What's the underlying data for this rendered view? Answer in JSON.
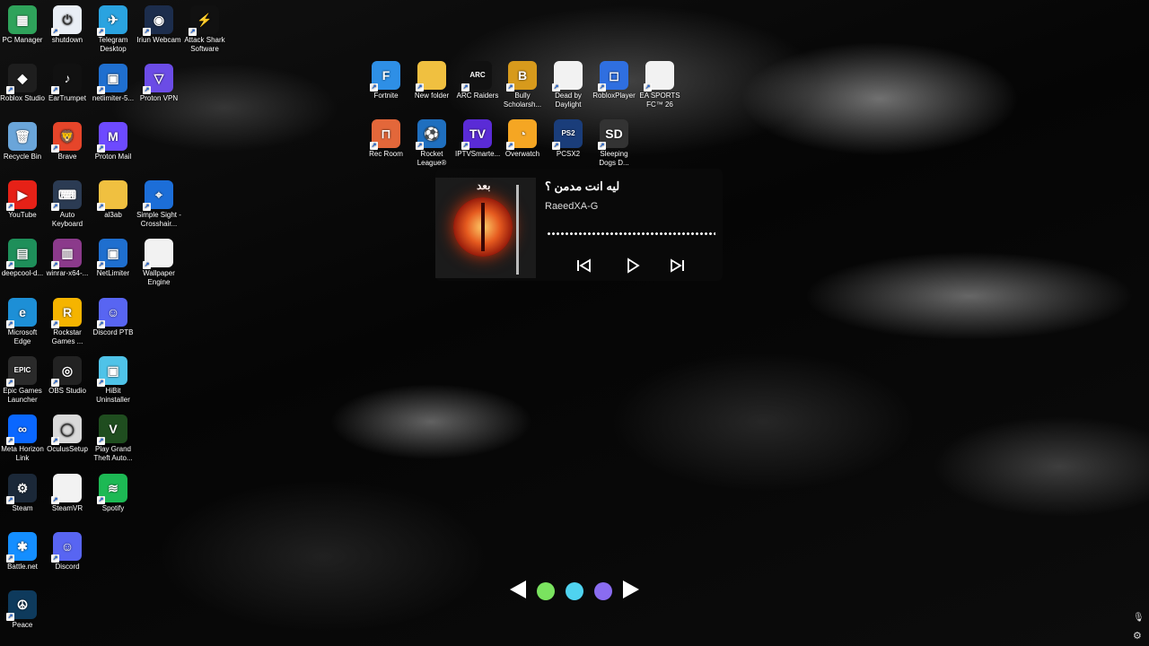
{
  "desktop_icons": [
    {
      "label": "PC Manager",
      "icon": "pc-manager-icon",
      "color": "#2fa35b",
      "glyph": "▦"
    },
    {
      "label": "shutdown",
      "icon": "shutdown-icon",
      "color": "#e9eef5",
      "glyph": "⏻"
    },
    {
      "label": "Telegram Desktop",
      "icon": "telegram-icon",
      "color": "#2aa3e0",
      "glyph": "✈"
    },
    {
      "label": "Iriun Webcam",
      "icon": "webcam-icon",
      "color": "#1c2d4c",
      "glyph": "◉"
    },
    {
      "label": "Attack Shark Software",
      "icon": "attack-shark-icon",
      "color": "#111111",
      "glyph": "⚡"
    },
    {
      "label": "Roblox Studio",
      "icon": "roblox-studio-icon",
      "color": "#1e1e1e",
      "glyph": "◆"
    },
    {
      "label": "EarTrumpet",
      "icon": "eartrumpet-icon",
      "color": "#111111",
      "glyph": "♪"
    },
    {
      "label": "netlimiter-5...",
      "icon": "netlimiter-icon",
      "color": "#1f6fcf",
      "glyph": "▣"
    },
    {
      "label": "Proton VPN",
      "icon": "proton-vpn-icon",
      "color": "#6b4ce6",
      "glyph": "▽"
    },
    {
      "label": "Recycle Bin",
      "icon": "recycle-bin-icon",
      "color": "#6aa5d9",
      "glyph": "🗑"
    },
    {
      "label": "Brave",
      "icon": "brave-icon",
      "color": "#e6452a",
      "glyph": "🦁"
    },
    {
      "label": "Proton Mail",
      "icon": "proton-mail-icon",
      "color": "#6d4aff",
      "glyph": "M"
    },
    {
      "label": "YouTube",
      "icon": "youtube-icon",
      "color": "#e62117",
      "glyph": "▶"
    },
    {
      "label": "Auto Keyboard",
      "icon": "auto-keyboard-icon",
      "color": "#2b3b53",
      "glyph": "⌨"
    },
    {
      "label": "al3ab",
      "icon": "folder-icon",
      "color": "#f0c040",
      "glyph": ""
    },
    {
      "label": "Simple Sight - Crosshair...",
      "icon": "crosshair-icon",
      "color": "#1c6ed8",
      "glyph": "⌖"
    },
    {
      "label": "deepcool-d...",
      "icon": "deepcool-icon",
      "color": "#1e8f5a",
      "glyph": "▤"
    },
    {
      "label": "winrar-x64-...",
      "icon": "winrar-icon",
      "color": "#8b3a8b",
      "glyph": "▥"
    },
    {
      "label": "NetLimiter",
      "icon": "netlimiter-app-icon",
      "color": "#1f6fcf",
      "glyph": "▣"
    },
    {
      "label": "Wallpaper Engine",
      "icon": "wallpaper-engine-icon",
      "color": "#f2f2f2",
      "glyph": ""
    },
    {
      "label": "Microsoft Edge",
      "icon": "edge-icon",
      "color": "#1d8fd6",
      "glyph": "e"
    },
    {
      "label": "Rockstar Games ...",
      "icon": "rockstar-icon",
      "color": "#f5b400",
      "glyph": "R"
    },
    {
      "label": "Discord PTB",
      "icon": "discord-ptb-icon",
      "color": "#5865f2",
      "glyph": "☺"
    },
    {
      "label": "Epic Games Launcher",
      "icon": "epic-games-icon",
      "color": "#2a2a2a",
      "glyph": "EPIC"
    },
    {
      "label": "OBS Studio",
      "icon": "obs-icon",
      "color": "#222222",
      "glyph": "◎"
    },
    {
      "label": "HiBit Uninstaller",
      "icon": "hibit-icon",
      "color": "#4fc3e8",
      "glyph": "▣"
    },
    {
      "label": "Meta Horizon Link",
      "icon": "meta-icon",
      "color": "#0a67ff",
      "glyph": "∞"
    },
    {
      "label": "OculusSetup",
      "icon": "oculus-icon",
      "color": "#d9d9d9",
      "glyph": "◯"
    },
    {
      "label": "Play Grand Theft Auto...",
      "icon": "gta-icon",
      "color": "#1f4d1f",
      "glyph": "V"
    },
    {
      "label": "Steam",
      "icon": "steam-icon",
      "color": "#1b2838",
      "glyph": "⚙"
    },
    {
      "label": "SteamVR",
      "icon": "steamvr-icon",
      "color": "#f2f2f2",
      "glyph": ""
    },
    {
      "label": "Spotify",
      "icon": "spotify-icon",
      "color": "#1db954",
      "glyph": "≋"
    },
    {
      "label": "Battle.net",
      "icon": "battlenet-icon",
      "color": "#148eff",
      "glyph": "✱"
    },
    {
      "label": "Discord",
      "icon": "discord-icon",
      "color": "#5865f2",
      "glyph": "☺"
    },
    {
      "label": "Peace",
      "icon": "peace-icon",
      "color": "#0e3a5c",
      "glyph": "☮"
    },
    {
      "label": "Fortnite",
      "icon": "fortnite-icon",
      "color": "#2e8fe6",
      "glyph": "F"
    },
    {
      "label": "New folder",
      "icon": "new-folder-icon",
      "color": "#f0c040",
      "glyph": ""
    },
    {
      "label": "ARC Raiders",
      "icon": "arc-raiders-icon",
      "color": "#111111",
      "glyph": "ARC"
    },
    {
      "label": "Bully Scholarsh...",
      "icon": "bully-icon",
      "color": "#d79a1c",
      "glyph": "B"
    },
    {
      "label": "Dead by Daylight",
      "icon": "dbd-icon",
      "color": "#f2f2f2",
      "glyph": ""
    },
    {
      "label": "RobloxPlayer",
      "icon": "roblox-player-icon",
      "color": "#2f6fe0",
      "glyph": "◻"
    },
    {
      "label": "EA SPORTS FC™ 26",
      "icon": "ea-fc-icon",
      "color": "#f2f2f2",
      "glyph": ""
    },
    {
      "label": "Rec Room",
      "icon": "rec-room-icon",
      "color": "#e3673a",
      "glyph": "⊓"
    },
    {
      "label": "Rocket League®",
      "icon": "rocket-league-icon",
      "color": "#1f6fbf",
      "glyph": "⚽"
    },
    {
      "label": "IPTVSmarte...",
      "icon": "iptv-icon",
      "color": "#5a2bd6",
      "glyph": "TV"
    },
    {
      "label": "Overwatch",
      "icon": "overwatch-icon",
      "color": "#f5a623",
      "glyph": "◔"
    },
    {
      "label": "PCSX2",
      "icon": "pcsx2-icon",
      "color": "#1a3d7a",
      "glyph": "PS2"
    },
    {
      "label": "Sleeping Dogs D...",
      "icon": "sleeping-dogs-icon",
      "color": "#333333",
      "glyph": "SD"
    }
  ],
  "music_player": {
    "title": "ليه انت مدمن ؟",
    "artist": "RaeedXA-G",
    "album_art_text": "بعد",
    "controls": {
      "previous": "previous-track",
      "play": "play",
      "next": "next-track"
    }
  },
  "carousel": {
    "dots": [
      "#7ae35f",
      "#4fd3f0",
      "#8a6cf0"
    ]
  }
}
